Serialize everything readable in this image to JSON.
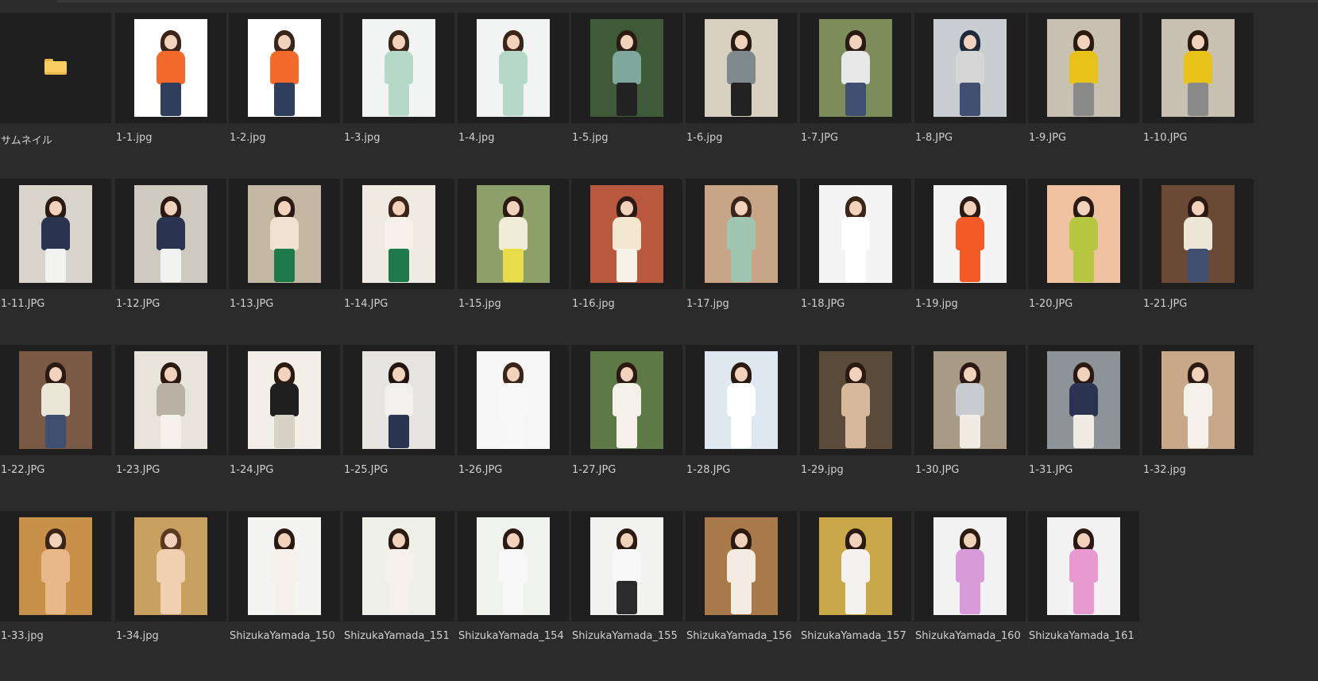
{
  "files": [
    {
      "name": "サムネイル",
      "kind": "folder",
      "icon": "folder-icon"
    },
    {
      "name": "1-1.jpg",
      "bg": "#ffffff",
      "hair": "#3b2418",
      "top": "#f26a2c",
      "bottom": "#2f3e5a"
    },
    {
      "name": "1-2.jpg",
      "bg": "#ffffff",
      "hair": "#3b2418",
      "top": "#f26a2c",
      "bottom": "#2f3e5a"
    },
    {
      "name": "1-3.jpg",
      "bg": "#f2f4f3",
      "hair": "#3b2418",
      "top": "#b6d8c9",
      "bottom": "#b6d8c9"
    },
    {
      "name": "1-4.jpg",
      "bg": "#f2f4f3",
      "hair": "#3b2418",
      "top": "#b6d8c9",
      "bottom": "#b6d8c9"
    },
    {
      "name": "1-5.jpg",
      "bg": "#3e5a38",
      "hair": "#2b1a12",
      "top": "#7fa79c",
      "bottom": "#222222"
    },
    {
      "name": "1-6.jpg",
      "bg": "#d9d0c0",
      "hair": "#2b1a12",
      "top": "#7e8a8e",
      "bottom": "#222222"
    },
    {
      "name": "1-7.JPG",
      "bg": "#7c8c5a",
      "hair": "#2b1a12",
      "top": "#e8e8e8",
      "bottom": "#3f4f72"
    },
    {
      "name": "1-8.JPG",
      "bg": "#c9cfd0",
      "hair": "#1f2a3c",
      "top": "#d6d6d6",
      "bottom": "#3f4f72"
    },
    {
      "name": "1-9.JPG",
      "bg": "#c8c0b0",
      "hair": "#2b1a12",
      "top": "#e8c21a",
      "bottom": "#8a8a8a"
    },
    {
      "name": "1-10.JPG",
      "bg": "#c8c0b0",
      "hair": "#2b1a12",
      "top": "#e8c21a",
      "bottom": "#8a8a8a"
    },
    {
      "name": "1-11.JPG",
      "bg": "#d8d4cc",
      "hair": "#2b1a12",
      "top": "#2a3350",
      "bottom": "#f2f2f0"
    },
    {
      "name": "1-12.JPG",
      "bg": "#cfcac0",
      "hair": "#2b1a12",
      "top": "#2a3350",
      "bottom": "#f2f2f0"
    },
    {
      "name": "1-13.JPG",
      "bg": "#c4b8a4",
      "hair": "#2b1a12",
      "top": "#f0e2d2",
      "bottom": "#1e7a4a"
    },
    {
      "name": "1-14.JPG",
      "bg": "#f0ebe2",
      "hair": "#3b2418",
      "top": "#f4f0ea",
      "bottom": "#1e7a4a"
    },
    {
      "name": "1-15.jpg",
      "bg": "#8ea06a",
      "hair": "#2b1a12",
      "top": "#f0ecd8",
      "bottom": "#e9dc4a"
    },
    {
      "name": "1-16.jpg",
      "bg": "#b8583e",
      "hair": "#2b1a12",
      "top": "#f2e7cf",
      "bottom": "#f6f2ea"
    },
    {
      "name": "1-17.jpg",
      "bg": "#c9a587",
      "hair": "#3b2418",
      "top": "#9ec6b0",
      "bottom": "#9ec6b0"
    },
    {
      "name": "1-18.JPG",
      "bg": "#f4f4f4",
      "hair": "#3b2418",
      "top": "#ffffff",
      "bottom": "#ffffff"
    },
    {
      "name": "1-19.jpg",
      "bg": "#f4f4f4",
      "hair": "#2b1a12",
      "top": "#f25a26",
      "bottom": "#f25a26"
    },
    {
      "name": "1-20.JPG",
      "bg": "#f1c2a2",
      "hair": "#2b1a12",
      "top": "#b6c742",
      "bottom": "#b6c742"
    },
    {
      "name": "1-21.JPG",
      "bg": "#6a4a36",
      "hair": "#2b1a12",
      "top": "#ece6d6",
      "bottom": "#3f4f72"
    },
    {
      "name": "1-22.JPG",
      "bg": "#7a5a44",
      "hair": "#2b1a12",
      "top": "#ece6d6",
      "bottom": "#3f4f72"
    },
    {
      "name": "1-23.JPG",
      "bg": "#e8e4dc",
      "hair": "#2b1a12",
      "top": "#b8b0a4",
      "bottom": "#f4f0ea"
    },
    {
      "name": "1-24.JPG",
      "bg": "#f2efe8",
      "hair": "#2b1a12",
      "top": "#1e1e1e",
      "bottom": "#d8d2c6"
    },
    {
      "name": "1-25.JPG",
      "bg": "#e6e4e0",
      "hair": "#1f1410",
      "top": "#f2f0ea",
      "bottom": "#2a3350"
    },
    {
      "name": "1-26.JPG",
      "bg": "#f6f6f6",
      "hair": "#3b2418",
      "top": "#f8f8f8",
      "bottom": "#f8f8f8"
    },
    {
      "name": "1-27.JPG",
      "bg": "#5d7a46",
      "hair": "#2b1a12",
      "top": "#f4f0ea",
      "bottom": "#f4f0ea"
    },
    {
      "name": "1-28.JPG",
      "bg": "#dfe8f0",
      "hair": "#2b1a12",
      "top": "#ffffff",
      "bottom": "#ffffff"
    },
    {
      "name": "1-29.jpg",
      "bg": "#5a4a3a",
      "hair": "#2b1a12",
      "top": "#d8b89a",
      "bottom": "#d8b89a"
    },
    {
      "name": "1-30.JPG",
      "bg": "#a89a84",
      "hair": "#2b1a12",
      "top": "#c8ccd0",
      "bottom": "#f0ece4"
    },
    {
      "name": "1-31.JPG",
      "bg": "#8c949a",
      "hair": "#2b1a12",
      "top": "#2a3350",
      "bottom": "#f0ece4"
    },
    {
      "name": "1-32.jpg",
      "bg": "#c8a888",
      "hair": "#2b1a12",
      "top": "#f4f0ea",
      "bottom": "#f4f0ea"
    },
    {
      "name": "1-33.jpg",
      "bg": "#c89048",
      "hair": "#3b2418",
      "top": "#e8b888",
      "bottom": "#e8b888"
    },
    {
      "name": "1-34.jpg",
      "bg": "#c8a060",
      "hair": "#5a3a22",
      "top": "#f0d0b0",
      "bottom": "#f0d0b0"
    },
    {
      "name": "ShizukaYamada_150",
      "bg": "#f4f4f2",
      "hair": "#2b1a12",
      "top": "#f4f0ea",
      "bottom": "#f4f0ea"
    },
    {
      "name": "ShizukaYamada_151",
      "bg": "#eef0e8",
      "hair": "#2b1a12",
      "top": "#f4f0ea",
      "bottom": "#f4f0ea"
    },
    {
      "name": "ShizukaYamada_154",
      "bg": "#f0f2ee",
      "hair": "#2b1a12",
      "top": "#f8f8f8",
      "bottom": "#f8f8f8"
    },
    {
      "name": "ShizukaYamada_155",
      "bg": "#f2f2f0",
      "hair": "#2b1a12",
      "top": "#f8f8f8",
      "bottom": "#2a2a2a"
    },
    {
      "name": "ShizukaYamada_156",
      "bg": "#a87a4a",
      "hair": "#2b1a12",
      "top": "#f4ece2",
      "bottom": "#f4ece2"
    },
    {
      "name": "ShizukaYamada_157",
      "bg": "#c8a848",
      "hair": "#2b1a12",
      "top": "#f4f2ee",
      "bottom": "#f4f2ee"
    },
    {
      "name": "ShizukaYamada_160",
      "bg": "#f2f2f2",
      "hair": "#2b1a12",
      "top": "#d89ad8",
      "bottom": "#d89ad8"
    },
    {
      "name": "ShizukaYamada_161",
      "bg": "#f2f2f2",
      "hair": "#2b1a12",
      "top": "#e89ad0",
      "bottom": "#e89ad0"
    }
  ]
}
